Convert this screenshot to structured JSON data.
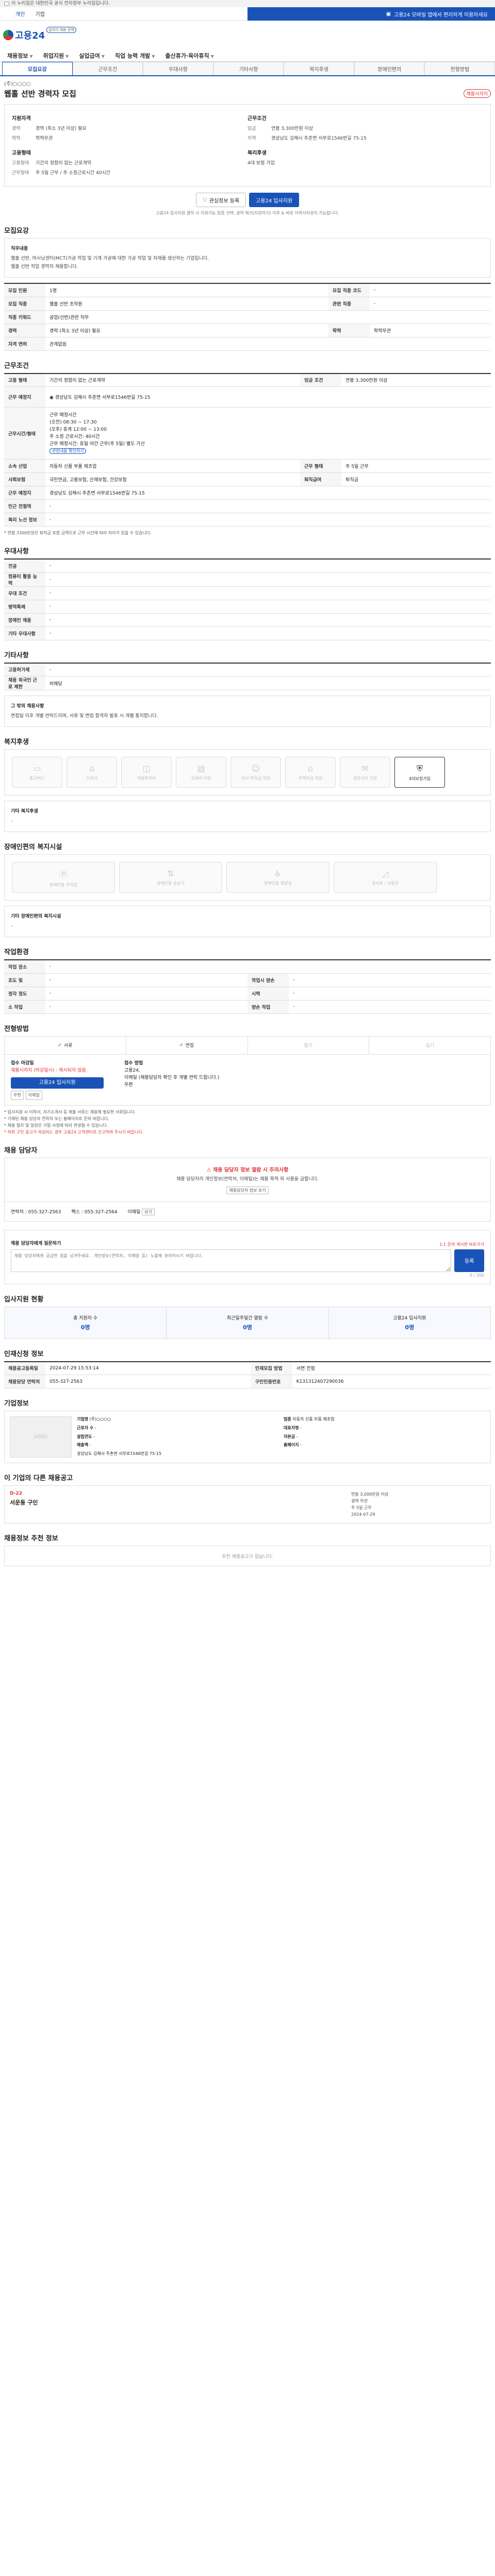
{
  "gov_banner": "이 누리집은 대한민국 공식 전자정부 누리집입니다.",
  "topbar": {
    "items": [
      "개인",
      "기업"
    ],
    "right": "고용24 모바일 앱에서 편리하게 이용하세요"
  },
  "logo": {
    "name": "고용24",
    "badge": "일자리 채용 정책"
  },
  "gnb": [
    "채용정보",
    "취업지원",
    "실업급여",
    "직업 능력 개발",
    "출산휴가·육아휴직"
  ],
  "tabs": [
    "모집요강",
    "근무조건",
    "우대사항",
    "기타사항",
    "복지후생",
    "장애인편의",
    "전형방법"
  ],
  "header": {
    "company": "(주)○○○○",
    "title": "웹홀 선반 경력자 모집",
    "deadline_badge": "채용시까지"
  },
  "summary": {
    "left_h": "지원자격",
    "left": [
      {
        "k": "경력",
        "v": "경력 (최소 3년 이상) 필요"
      },
      {
        "k": "학력",
        "v": "학력무관"
      }
    ],
    "left_h2": "고용형태",
    "left2": [
      {
        "k": "고용형태",
        "v": "기간의 정함이 없는 근로계약"
      },
      {
        "k": "근무형태",
        "v": "주 5일 근무 / 주 소정근로시간 40시간"
      }
    ],
    "right_h": "근무조건",
    "right": [
      {
        "k": "임금",
        "v": "연봉 3,300만원 이상"
      },
      {
        "k": "지역",
        "v": "경상남도 김해시 주촌면 서부로1546번길 75-15"
      }
    ],
    "right_h2": "복리후생",
    "right2": [
      {
        "k": "",
        "v": "4대 보험 가입"
      }
    ]
  },
  "actions": {
    "scrap": "관심정보 등록",
    "apply": "고용24 입사지원"
  },
  "actions_note": "고용24 입사지원 클릭 시 지원가능 업종 선택, 경력 체크(지원하기) 이후 & 바로 이력서작성이 가능합니다.",
  "recruit": {
    "title": "모집요강",
    "duty_h": "직무내용",
    "duty": "웹홀 선반, 머시닝센터(MCT)가공 작업 및 기계 가공에 대한 가공 작업 및 자재를 생산하는 기업입니다.",
    "duty2": "웹홀 선반 작업 경력자 채용합니다.",
    "rows": [
      [
        "모집 인원",
        "1명",
        "모집 직종 코드",
        "-"
      ],
      [
        "모집 직종",
        "웹홀 선반 조작원",
        "관련 직종",
        "-"
      ],
      [
        "직종 키워드",
        "공업(선반)관련 직무",
        "",
        ""
      ],
      [
        "경력",
        "경력 (최소 3년 이상) 필요",
        "학력",
        "학력무관"
      ],
      [
        "자격 면허",
        "관계없음",
        "",
        ""
      ]
    ]
  },
  "cond": {
    "title": "근무조건",
    "rows": [
      [
        "고용 형태",
        "기간의 정함이 없는 근로계약",
        "임금 조건",
        "연봉 3,300만원 이상"
      ],
      [
        "근무 예정지",
        "경상남도 김해시 주촌면 서부로1546번길 75-15",
        "",
        ""
      ],
      [
        "소속 산업",
        "자동차 신품 부품 제조업",
        "근무 형태",
        "주 5일 근무"
      ],
      [
        "사회보험",
        "국민연금, 고용보험, 산재보험, 건강보험",
        "퇴직급여",
        "퇴직금"
      ],
      [
        "근무 예정지",
        "경상남도 김해시 주촌면 서부로1546번길 75-15",
        "",
        ""
      ],
      [
        "인근 전철역",
        "-",
        "",
        ""
      ],
      [
        "복리 노선 정보",
        "-",
        "",
        ""
      ]
    ],
    "hours_h": "근무시간/형태",
    "hours": [
      "근무 예정시간",
      "(오전) 08:30 ~ 17:30",
      "(오후) 휴게 12:00 ~ 13:00",
      "주 소정 근로시간: 40시간",
      "근무 예정시간: 휴일 야간 근무(주 5일) 별도 가산",
      "관련내용 확인하기"
    ],
    "info_note": "* 연봉 3300만원은 퇴직금 포함 금액으로 근무 시간에 따라 차이가 있을 수 있습니다."
  },
  "prefer": {
    "title": "우대사항",
    "rows": [
      [
        "전공",
        "-"
      ],
      [
        "컴퓨터 활용 능력",
        "-"
      ],
      [
        "우대 조건",
        "-"
      ],
      [
        "병역특례",
        "-"
      ],
      [
        "장애인 채용",
        "-"
      ],
      [
        "기타 우대사항",
        "-"
      ]
    ]
  },
  "etc": {
    "title": "기타사항",
    "rows": [
      [
        "고용허가제",
        "-"
      ],
      [
        "채용 외국인 근로 제한",
        "비해당"
      ]
    ],
    "notes_h": "그 밖의 채용사항",
    "notes": "면접일 이후 개별 연락드리며, 서류 및 면접 합격자 발표 시 개별 통지합니다."
  },
  "welfare": {
    "title": "복지후생",
    "items": [
      "통근버스",
      "기숙사",
      "차량유지비",
      "교육비 지원",
      "자녀 학자금 지원",
      "주택자금 지원",
      "경조사비 지원",
      "4대보험가입"
    ],
    "on": 7,
    "other_h": "기타 복지후생",
    "other": "-"
  },
  "disability": {
    "title": "장애인편의 복지시설",
    "items": [
      "장애인용 주차장",
      "장애인용 승강기",
      "장애인용 화장실",
      "경사로 / 자동문"
    ],
    "other_h": "기타 장애인편의 복지시설",
    "other": "-"
  },
  "workenv": {
    "title": "작업환경",
    "rows": [
      [
        "작업 장소",
        "-",
        "",
        ""
      ],
      [
        "조도 및",
        "-",
        "작업시 양손",
        "-"
      ],
      [
        "청각 정도",
        "-",
        "시력",
        "-"
      ],
      [
        "소 작업",
        "-",
        "양손 작업",
        "-"
      ]
    ]
  },
  "select": {
    "title": "전형방법",
    "methods": [
      "서류",
      "면접",
      "필기",
      "실기"
    ],
    "on": [
      0,
      1
    ],
    "left_h": "접수 마감일",
    "left_v": "채용시까지 (마감일시) : 제시되지 않음",
    "apply_btn": "고용24 입사지원",
    "apply2": "우편",
    "apply3": "이메일",
    "mid_h": "접수 방법",
    "mid": [
      "고용24,",
      "이메일 (채용담당자 확인 후 개별 연락 드립니다.)",
      "우편"
    ],
    "bullets": [
      "* 입사지원 시 이력서, 자기소개서 등 제출 서류는 채용에 필요한 서류입니다.",
      "* 기재된 채용 담당자 연락처 또는 홈페이지로 문의 바랍니다.",
      "* 채용 절차 및 일정은 기업 사정에 따라 변경될 수 있습니다.",
      "* 허위 구인 광고가 의심되는 경우 고용24 고객센터로 신고하여 주시기 바랍니다."
    ]
  },
  "contact": {
    "title": "채용 담당자",
    "warn_t": "채용 담당자 정보 열람 시 주의사항",
    "warn": "채용 담당자의 개인정보(연락처, 이메일)는 채용 목적 외 사용을 금합니다.",
    "warn_btn": "채용담당자 정보 보기",
    "phone_k": "연락처",
    "phone": "055-327-2563",
    "fax_k": "팩스",
    "fax": "055-327-2564",
    "mail_k": "이메일",
    "mail": "보기"
  },
  "inquiry": {
    "title": "채용 담당자에게 질문하기",
    "sub": "1:1 문의 게시판 바로가기",
    "ph": "채용 담당자에게 궁금한 점을 남겨주세요. 개인정보(연락처, 이메일 등) 노출에 유의하시기 바랍니다.",
    "count": "0 / 300",
    "submit": "등록"
  },
  "status": {
    "title": "입사지원 현황",
    "items": [
      [
        "총 지원자 수",
        "0명"
      ],
      [
        "최근일주일간 열람 수",
        "0명"
      ],
      [
        "고용24 입사지원",
        "0명"
      ]
    ]
  },
  "reginfo": {
    "title": "인재신청 정보",
    "rows": [
      [
        "채용공고등록일",
        "2024-07-29 15:53:14",
        "인재모집 방법",
        "서면 전형"
      ],
      [
        "채용담당 연락처",
        "055-327-2563",
        "구인인증번호",
        "K131312407290036"
      ]
    ]
  },
  "company": {
    "title": "기업정보",
    "rows": [
      [
        "기업명",
        "(주)○○○○"
      ],
      [
        "업종",
        "자동차 신품 부품 제조업"
      ],
      [
        "근로자 수",
        "-"
      ],
      [
        "대표자명",
        "-"
      ],
      [
        "설립연도",
        "-"
      ],
      [
        "자본금",
        "-"
      ],
      [
        "매출액",
        "-"
      ],
      [
        "홈페이지",
        "-"
      ]
    ],
    "addr": "경상남도 김해시 주촌면 서부로1546번길 75-15"
  },
  "others": {
    "title": "이 기업의 다른 채용공고",
    "d": "D-22",
    "job": "서운동 구인",
    "kvs": [
      "연봉 3,000만원 이상",
      "경력 무관",
      "주 5일 근무",
      "2024-07-29"
    ]
  },
  "suggest": {
    "title": "채용정보 추천 정보",
    "empty": "추천 채용공고가 없습니다."
  }
}
